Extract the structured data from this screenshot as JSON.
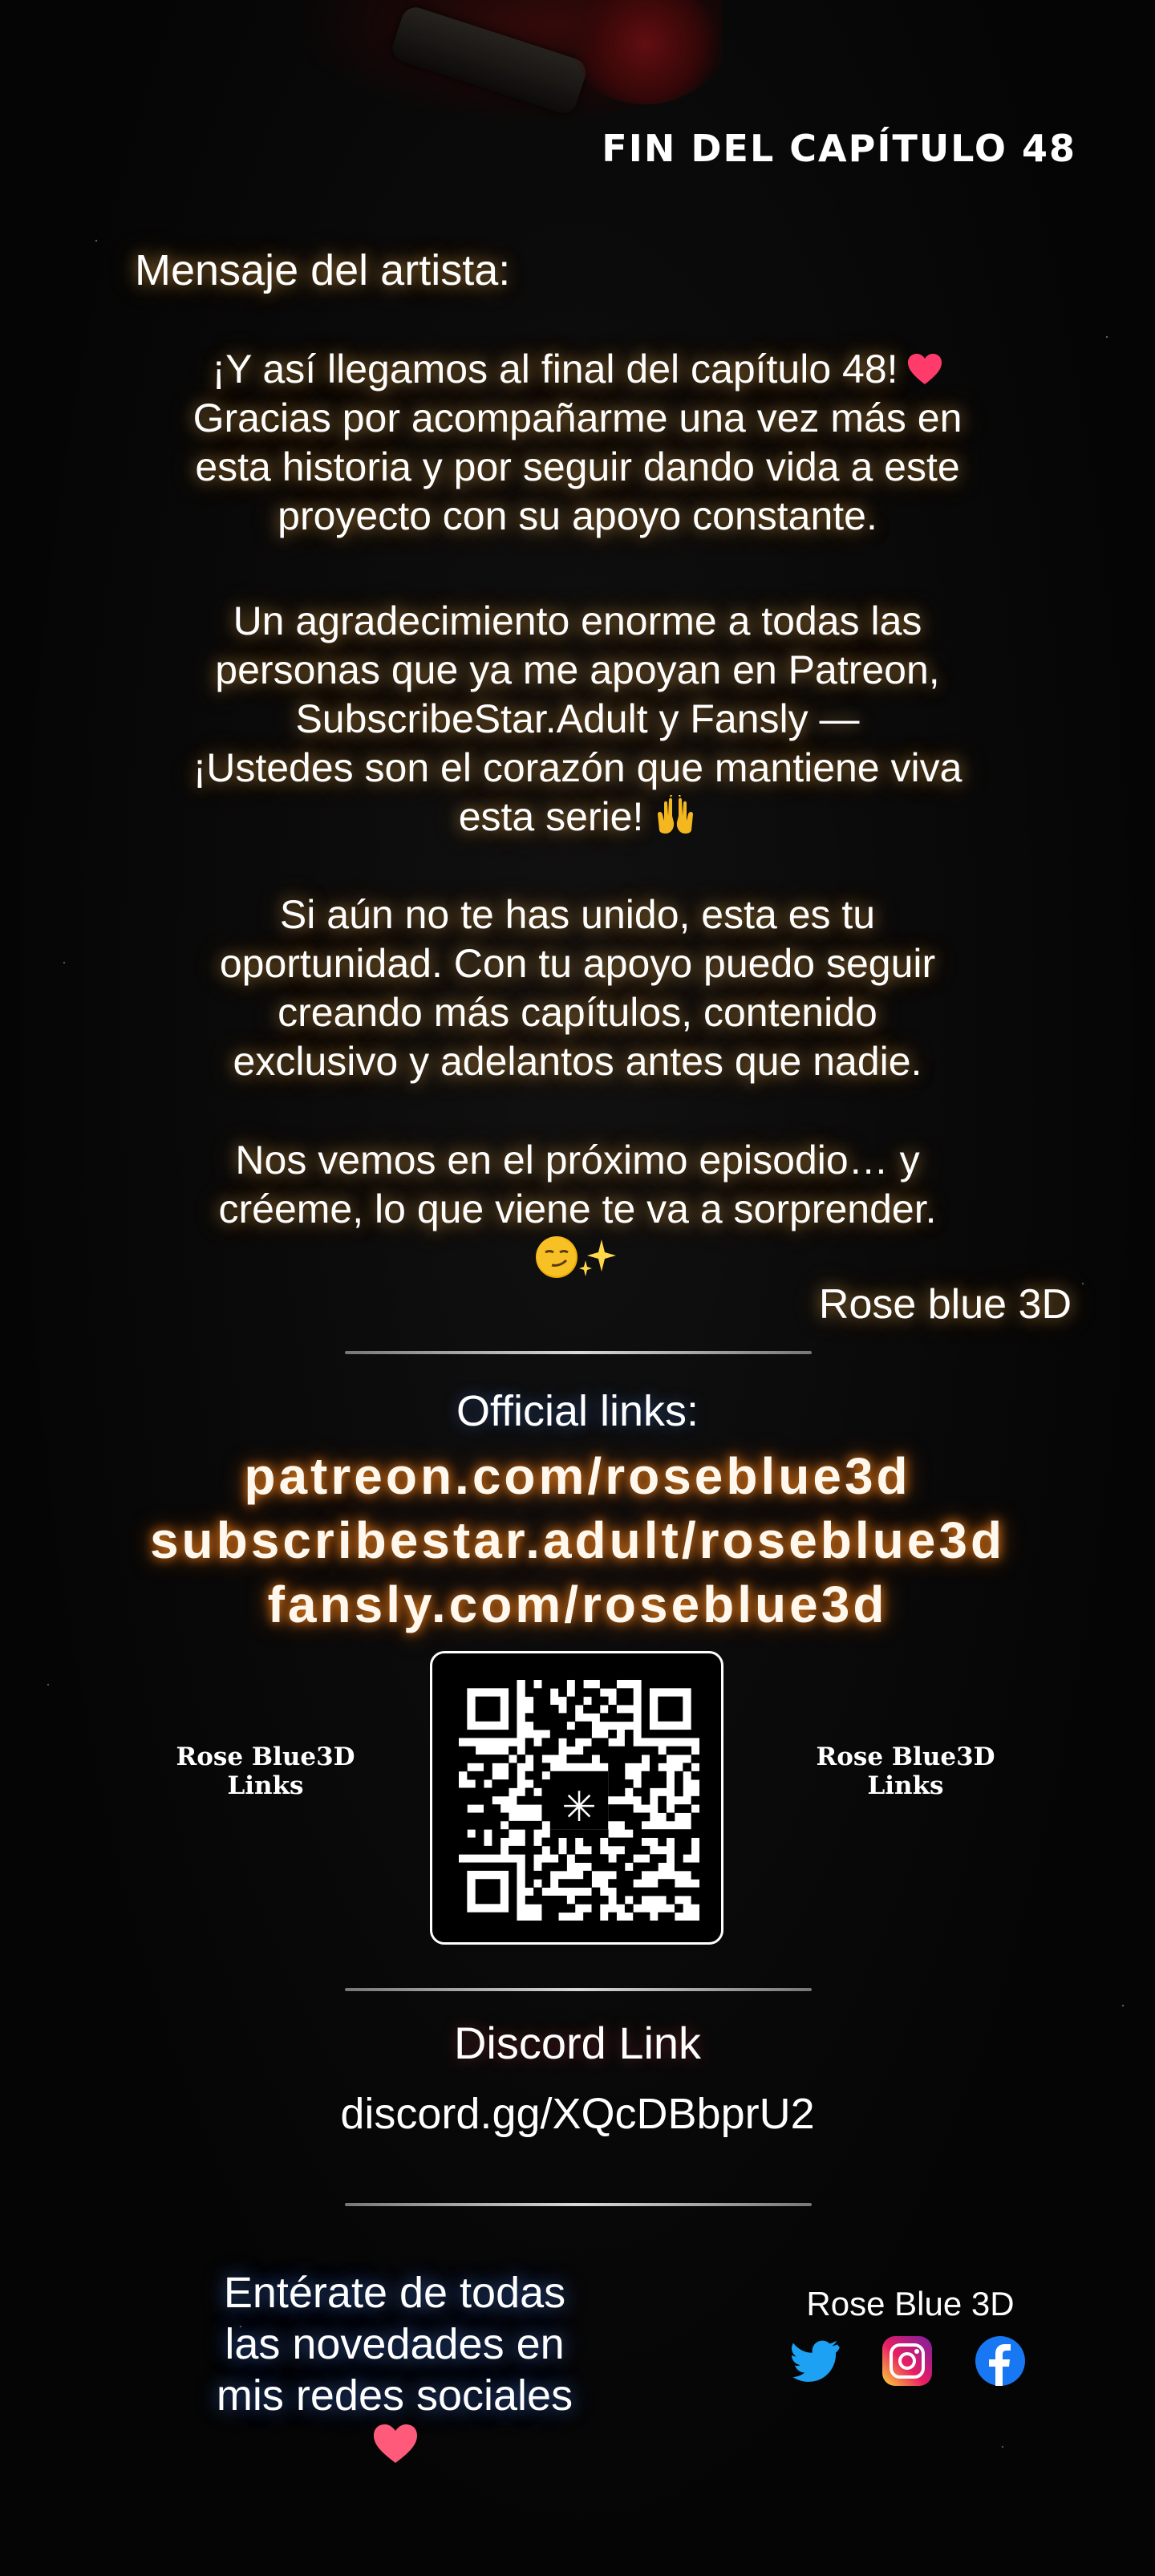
{
  "header": {
    "chapter_end": "FIN DEL CAPÍTULO 48"
  },
  "message": {
    "heading": "Mensaje del artista:",
    "p1": [
      "¡Y así llegamos al final del capítulo 48!",
      "Gracias por acompañarme una vez más en",
      "esta historia y por seguir dando vida a este",
      "proyecto con su apoyo constante."
    ],
    "p2": [
      "Un agradecimiento enorme a todas las",
      "personas que ya me apoyan en Patreon,",
      "SubscribeStar.Adult y Fansly —",
      "¡Ustedes son el corazón que mantiene viva",
      "esta serie!"
    ],
    "p3": [
      "Si aún no te has unido, esta es tu",
      "oportunidad. Con tu apoyo puedo seguir",
      "creando más capítulos, contenido",
      "exclusivo y adelantos antes que nadie."
    ],
    "p4": [
      "Nos vemos en el próximo episodio… y",
      "créeme, lo que viene te va a sorprender."
    ],
    "signature": "Rose blue 3D",
    "emoji": {
      "heart": "heart-icon",
      "hands": "raising-hands-icon",
      "smirk": "smirking-face-icon",
      "sparkles": "sparkles-icon"
    }
  },
  "links": {
    "label": "Official links:",
    "urls": [
      "patreon.com/roseblue3d",
      "subscribestar.adult/roseblue3d",
      "fansly.com/roseblue3d"
    ],
    "qr_label_left": [
      "Rose Blue3D",
      "Links"
    ],
    "qr_label_right": [
      "Rose Blue3D",
      "Links"
    ]
  },
  "discord": {
    "label": "Discord Link",
    "url": "discord.gg/XQcDBbprU2"
  },
  "social": {
    "text": [
      "Entérate de todas",
      "las novedades en",
      "mis redes sociales"
    ],
    "brand": "Rose Blue 3D",
    "icons": [
      "twitter-icon",
      "instagram-icon",
      "facebook-icon"
    ]
  },
  "colors": {
    "background": "#060606",
    "text_glow": "#ffbe5a",
    "link_glow": "#ff8c1e",
    "social_glow": "#508cff",
    "heart": "#ff3b6b",
    "twitter": "#1da1f2",
    "facebook": "#1877f2"
  }
}
